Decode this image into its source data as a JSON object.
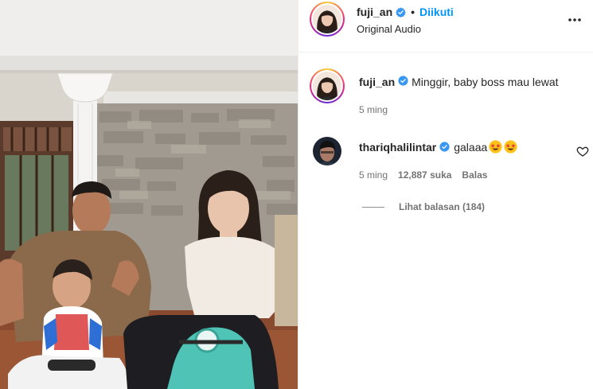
{
  "header": {
    "username": "fuji_an",
    "separator": "•",
    "follow_status": "Diikuti",
    "audio": "Original Audio",
    "more_icon": "more-horizontal-icon"
  },
  "caption": {
    "username": "fuji_an",
    "text": "Minggir, baby boss mau lewat",
    "time": "5 ming"
  },
  "comments": [
    {
      "username": "thariqhalilintar",
      "text": "galaaa",
      "emoji": "star-struck-emoji",
      "time": "5 ming",
      "likes": "12,887 suka",
      "reply_label": "Balas",
      "view_replies": "Lihat balasan (184)"
    }
  ],
  "colors": {
    "link_blue": "#0095f6",
    "verified_blue": "#3897f0",
    "muted_text": "#737373",
    "scooter_teal": "#4fc4b6"
  }
}
